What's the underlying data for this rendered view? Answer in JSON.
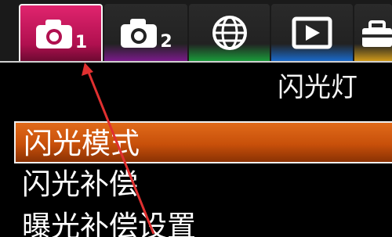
{
  "tabs": [
    {
      "id": "camera1",
      "icon": "camera-icon",
      "number": "1",
      "active": true,
      "accent": "#e0246e"
    },
    {
      "id": "camera2",
      "icon": "camera-icon",
      "number": "2",
      "active": false,
      "accent": "#7a1a8a"
    },
    {
      "id": "network",
      "icon": "globe-icon",
      "number": "",
      "active": false,
      "accent": "#1a9a3a"
    },
    {
      "id": "playback",
      "icon": "play-icon",
      "number": "",
      "active": false,
      "accent": "#1a6aca"
    },
    {
      "id": "setup",
      "icon": "toolbox-icon",
      "number": "",
      "active": false,
      "accent": "#d09a1a"
    }
  ],
  "section": {
    "title": "闪光灯"
  },
  "menu": {
    "items": [
      {
        "label": "闪光模式",
        "selected": true
      },
      {
        "label": "闪光补偿",
        "selected": false
      },
      {
        "label": "曝光补偿设置",
        "selected": false
      }
    ]
  },
  "colors": {
    "selection": "#d65a12",
    "annotation_arrow": "#e03030"
  }
}
